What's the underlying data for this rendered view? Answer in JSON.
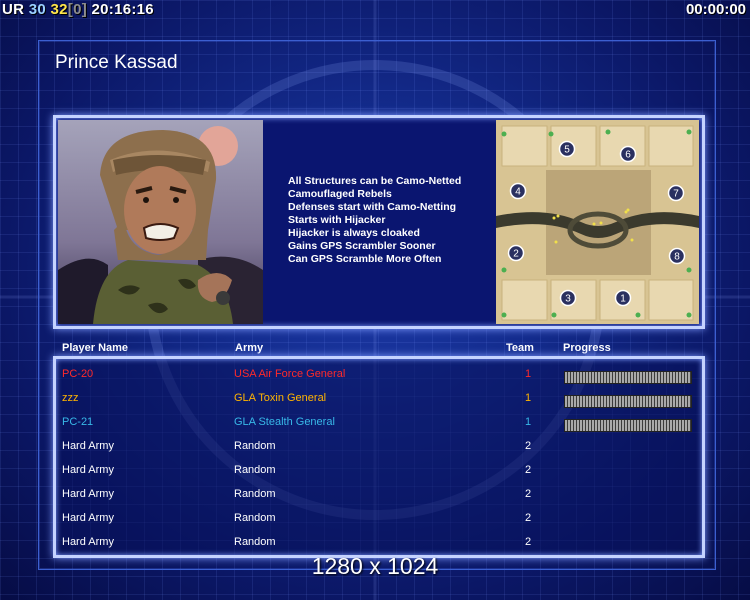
{
  "hud": {
    "prefix": "UR",
    "value_a": "30",
    "value_b": "32",
    "bracket": "[0]",
    "clock": "20:16:16",
    "timer": "00:00:00"
  },
  "general": {
    "name": "Prince Kassad",
    "traits": [
      "All Structures can be Camo-Netted",
      "Camouflaged Rebels",
      "Defenses start with Camo-Netting",
      "Starts with Hijacker",
      "Hijacker is always cloaked",
      "Gains GPS Scrambler Sooner",
      "Can GPS Scramble More Often"
    ]
  },
  "minimap": {
    "start_positions": [
      "1",
      "2",
      "3",
      "4",
      "5",
      "6",
      "7",
      "8"
    ]
  },
  "table": {
    "headers": {
      "player": "Player Name",
      "army": "Army",
      "team": "Team",
      "progress": "Progress"
    },
    "rows": [
      {
        "player": "PC-20",
        "army": "USA Air Force General",
        "team": "1",
        "color": "#ff2a2a",
        "loading": true
      },
      {
        "player": "zzz",
        "army": "GLA Toxin General",
        "team": "1",
        "color": "#ffb400",
        "loading": true
      },
      {
        "player": "PC-21",
        "army": "GLA Stealth General",
        "team": "1",
        "color": "#38b8e8",
        "loading": true
      },
      {
        "player": "Hard Army",
        "army": "Random",
        "team": "2",
        "color": "#ffffff",
        "loading": false
      },
      {
        "player": "Hard Army",
        "army": "Random",
        "team": "2",
        "color": "#ffffff",
        "loading": false
      },
      {
        "player": "Hard Army",
        "army": "Random",
        "team": "2",
        "color": "#ffffff",
        "loading": false
      },
      {
        "player": "Hard Army",
        "army": "Random",
        "team": "2",
        "color": "#ffffff",
        "loading": false
      },
      {
        "player": "Hard Army",
        "army": "Random",
        "team": "2",
        "color": "#ffffff",
        "loading": false
      }
    ]
  },
  "resolution": "1280 x 1024"
}
